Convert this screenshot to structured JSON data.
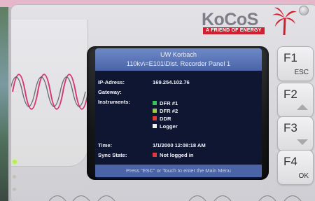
{
  "logo": {
    "brand": "KoCoS",
    "tagline": "A FRIEND OF ENERGY"
  },
  "screen": {
    "title_line1": "UW Korbach",
    "title_line2": "110kv\\=E101\\Dist. Recorder Panel 1",
    "ip_label": "IP-Adress:",
    "ip_value": "169.254.102.76",
    "gateway_label": "Gateway:",
    "instruments_label": "Instruments:",
    "instruments": [
      {
        "name": "DFR #1",
        "color": "#38c25a"
      },
      {
        "name": "DFR #2",
        "color": "#9fcf4a"
      },
      {
        "name": "DDR",
        "color": "#e03a3a"
      },
      {
        "name": "Logger",
        "color": "#f0f0f0"
      }
    ],
    "time_label": "Time:",
    "time_value": "1/1/2000 12:08:18 AM",
    "sync_label": "Sync State:",
    "sync_value": "Not logged in",
    "sync_color": "#e03a3a",
    "footer": "Press \"ESC\" or Touch to enter the Main Menu"
  },
  "fkeys": [
    {
      "key": "F1",
      "sub": "ESC"
    },
    {
      "key": "F2",
      "sub": "up-arrow-icon"
    },
    {
      "key": "F3",
      "sub": "down-arrow-icon"
    },
    {
      "key": "F4",
      "sub": "OK"
    }
  ]
}
